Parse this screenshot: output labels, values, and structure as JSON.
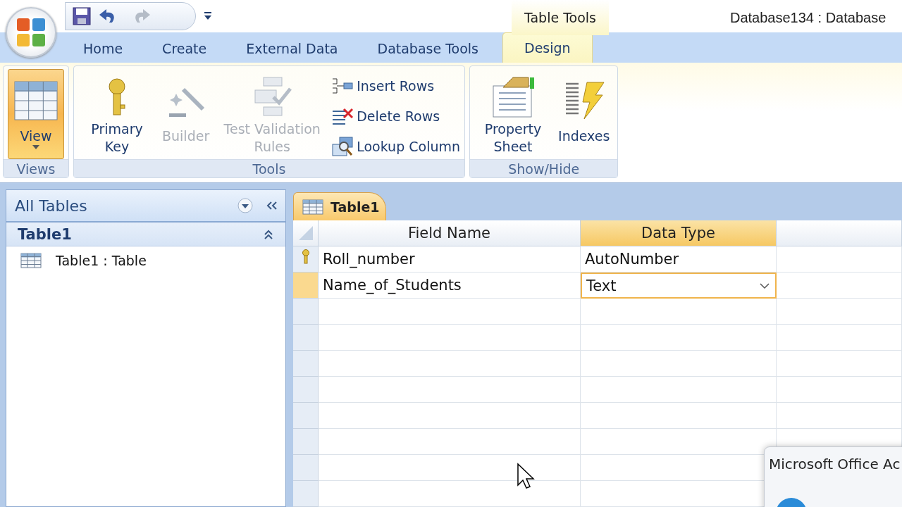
{
  "quick_access": [
    {
      "kind": "save",
      "disabled": false
    },
    {
      "kind": "undo",
      "disabled": false
    },
    {
      "kind": "redo",
      "disabled": true
    }
  ],
  "contextual_label": "Table Tools",
  "window": {
    "title": "Database134 : Database"
  },
  "tabs": [
    {
      "label": "Home",
      "selected": false
    },
    {
      "label": "Create",
      "selected": false
    },
    {
      "label": "External Data",
      "selected": false
    },
    {
      "label": "Database Tools",
      "selected": false
    },
    {
      "label": "Design",
      "selected": true
    }
  ],
  "ribbon": [
    {
      "name": "Views",
      "buttons": [
        {
          "kind": "view",
          "label": "View",
          "disabled": false
        }
      ]
    },
    {
      "name": "Tools",
      "buttons": [
        {
          "kind": "key",
          "label": "Primary Key",
          "disabled": false
        },
        {
          "kind": "builder",
          "label": "Builder",
          "disabled": true
        },
        {
          "kind": "validate",
          "label": "Test Validation Rules",
          "disabled": true
        },
        {
          "kind": "insert",
          "label": "Insert Rows",
          "disabled": false
        },
        {
          "kind": "delete",
          "label": "Delete Rows",
          "disabled": false
        },
        {
          "kind": "lookup",
          "label": "Lookup Column",
          "disabled": false
        }
      ]
    },
    {
      "name": "Show/Hide",
      "buttons": [
        {
          "kind": "sheet",
          "label": "Property Sheet",
          "disabled": false
        },
        {
          "kind": "indexes",
          "label": "Indexes",
          "disabled": false
        }
      ]
    }
  ],
  "nav": {
    "header": "All Tables",
    "groups": [
      {
        "label": "Table1",
        "expanded": true,
        "items": [
          {
            "label": "Table1 : Table"
          }
        ]
      }
    ]
  },
  "document_tab": {
    "label": "Table1"
  },
  "design_grid": {
    "columns": [
      {
        "label": "Field Name",
        "selected": false
      },
      {
        "label": "Data Type",
        "selected": true
      }
    ],
    "rows": [
      {
        "field_name": "Roll_number",
        "data_type": "AutoNumber",
        "primary_key": true,
        "selected": false
      },
      {
        "field_name": "Name_of_Students",
        "data_type": "Text",
        "primary_key": false,
        "selected": true
      }
    ]
  },
  "dialog": {
    "title": "Microsoft Office Ac"
  }
}
